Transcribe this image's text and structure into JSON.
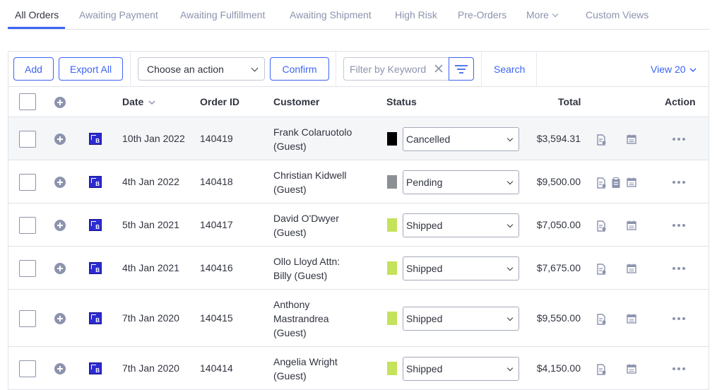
{
  "tabs": [
    {
      "label": "All Orders",
      "active": true
    },
    {
      "label": "Awaiting Payment"
    },
    {
      "label": "Awaiting Fulfillment"
    },
    {
      "label": "Awaiting Shipment"
    },
    {
      "label": "High Risk"
    },
    {
      "label": "Pre-Orders"
    },
    {
      "label": "More"
    },
    {
      "label": "Custom Views"
    }
  ],
  "toolbar": {
    "add_label": "Add",
    "export_label": "Export All",
    "action_select_value": "Choose an action",
    "confirm_label": "Confirm",
    "filter_placeholder": "Filter by Keyword",
    "search_label": "Search",
    "view_label": "View 20"
  },
  "table": {
    "columns": {
      "date": "Date",
      "order_id": "Order ID",
      "customer": "Customer",
      "status": "Status",
      "total": "Total",
      "action": "Action"
    },
    "rows": [
      {
        "date": "10th Jan 2022",
        "order_id": "140419",
        "customer_lines": [
          "Frank Colaruotolo",
          "(Guest)"
        ],
        "status": "Cancelled",
        "status_color": "#000000",
        "total": "$3,594.31",
        "highlighted": true,
        "extra_icon": false
      },
      {
        "date": "4th Jan 2022",
        "order_id": "140418",
        "customer_lines": [
          "Christian Kidwell",
          "(Guest)"
        ],
        "status": "Pending",
        "status_color": "#8c8f93",
        "total": "$9,500.00",
        "highlighted": false,
        "extra_icon": true
      },
      {
        "date": "5th Jan 2021",
        "order_id": "140417",
        "customer_lines": [
          "David O'Dwyer",
          "(Guest)"
        ],
        "status": "Shipped",
        "status_color": "#c4e25a",
        "total": "$7,050.00",
        "highlighted": false,
        "extra_icon": false
      },
      {
        "date": "4th Jan 2021",
        "order_id": "140416",
        "customer_lines": [
          "Ollo Lloyd Attn:",
          "Billy (Guest)"
        ],
        "status": "Shipped",
        "status_color": "#c4e25a",
        "total": "$7,675.00",
        "highlighted": false,
        "extra_icon": false
      },
      {
        "date": "7th Jan 2020",
        "order_id": "140415",
        "customer_lines": [
          "Anthony",
          "Mastrandrea",
          "(Guest)"
        ],
        "status": "Shipped",
        "status_color": "#c4e25a",
        "total": "$9,550.00",
        "highlighted": false,
        "extra_icon": false
      },
      {
        "date": "7th Jan 2020",
        "order_id": "140414",
        "customer_lines": [
          "Angelia Wright",
          "(Guest)"
        ],
        "status": "Shipped",
        "status_color": "#c4e25a",
        "total": "$4,150.00",
        "highlighted": false,
        "extra_icon": false
      }
    ]
  },
  "colors": {
    "accent": "#3c64f4",
    "muted_text": "#8c93ad",
    "border": "#dfe3e8",
    "channel_icon": "#2d2bcf"
  },
  "icons": {
    "add_row": "plus-circle-icon",
    "channel": "bigcommerce-b-icon",
    "invoice": "invoice-icon",
    "packing_slip": "clipboard-icon",
    "calendar": "calendar-icon",
    "more": "ellipsis-icon",
    "clear": "close-icon",
    "filter": "filter-icon"
  }
}
